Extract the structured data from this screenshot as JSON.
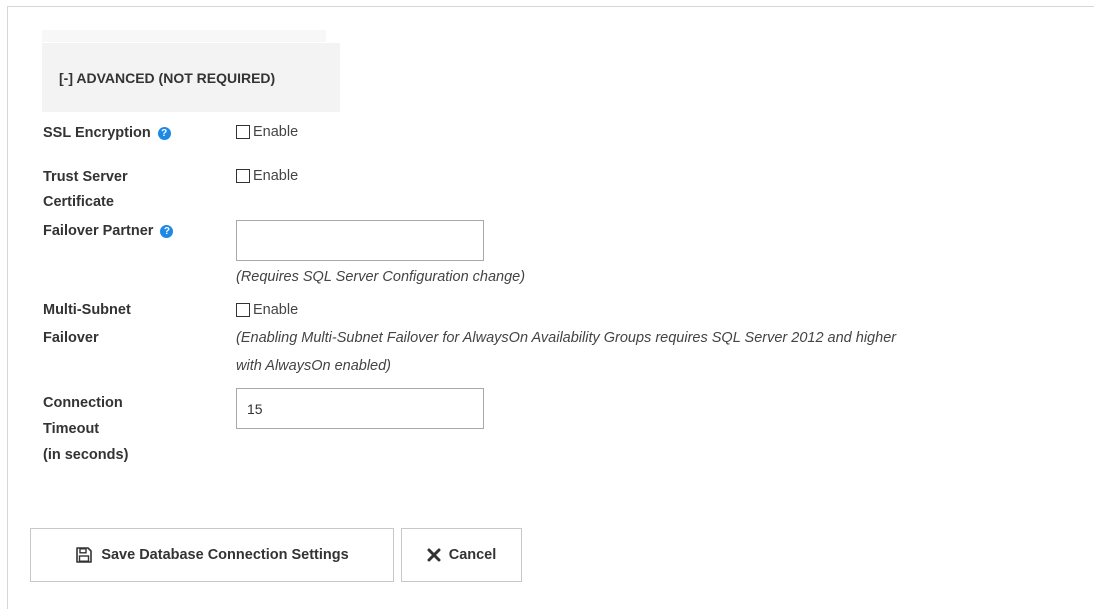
{
  "section": {
    "title": "[-] ADVANCED (NOT REQUIRED)"
  },
  "fields": {
    "ssl": {
      "label": "SSL Encryption",
      "checkbox_label": "Enable",
      "checked": false
    },
    "trust": {
      "label_line1": "Trust Server",
      "label_line2": "Certificate",
      "checkbox_label": "Enable",
      "checked": false
    },
    "failover_partner": {
      "label": "Failover Partner",
      "value": "",
      "note": "(Requires SQL Server Configuration change)"
    },
    "multi_subnet": {
      "label_line1": "Multi-Subnet",
      "label_line2": "Failover",
      "checkbox_label": "Enable",
      "checked": false,
      "note_line1": "(Enabling Multi-Subnet Failover for AlwaysOn Availability Groups requires SQL Server 2012 and higher",
      "note_line2": "with AlwaysOn enabled)"
    },
    "timeout": {
      "label_line1": "Connection",
      "label_line2": "Timeout",
      "label_line3": "(in seconds)",
      "value": "15"
    }
  },
  "buttons": {
    "save": "Save Database Connection Settings",
    "cancel": "Cancel"
  },
  "icons": {
    "help": "help-circle-icon",
    "save": "floppy-disk-icon",
    "cancel": "x-icon"
  },
  "colors": {
    "help_icon": "#1e88e5",
    "header_bg": "#f3f3f3"
  }
}
